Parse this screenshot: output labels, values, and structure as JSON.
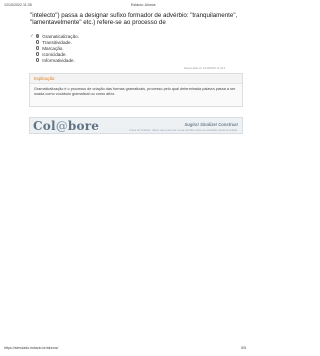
{
  "header": {
    "datetime": "12/10/2022 11:35",
    "title": "Estácio: Alunos"
  },
  "question": {
    "text": "\"intelecto\") passa a designar sufixo formador de advérbio: \"tranquilamente\", \"lamentavelmente\" etc.) refere-se ao processo de"
  },
  "options": [
    {
      "label": "Gramaticalização.",
      "mark": "✓",
      "selected": true
    },
    {
      "label": "Transitividade.",
      "mark": "",
      "selected": false
    },
    {
      "label": "Marcação.",
      "mark": "",
      "selected": false
    },
    {
      "label": "Iconicidade.",
      "mark": "",
      "selected": false
    },
    {
      "label": "Informatividade.",
      "mark": "",
      "selected": false
    }
  ],
  "stamp": "Respondido em 12/10/2022 11:34:3",
  "explanation": {
    "heading": "Explicação:",
    "text": "Gramaticalização  é  o  processo  de  criação  das  formas  gramaticais,  processo  pelo  qual  determinada  palavra passa a ser usada  como vocábulo gramatical ou como afixo."
  },
  "banner": {
    "logo_a": "Col",
    "logo_at": "@",
    "logo_b": "bore",
    "slogan": "Sugira! Sinalize! Construa!",
    "tagline": "Antes de finalizar, clique aqui para dar a sua opinião sobre as questões deste simulado."
  },
  "footer": {
    "url": "https://simulado.estacio.br/alunos/",
    "page": "5/5"
  }
}
